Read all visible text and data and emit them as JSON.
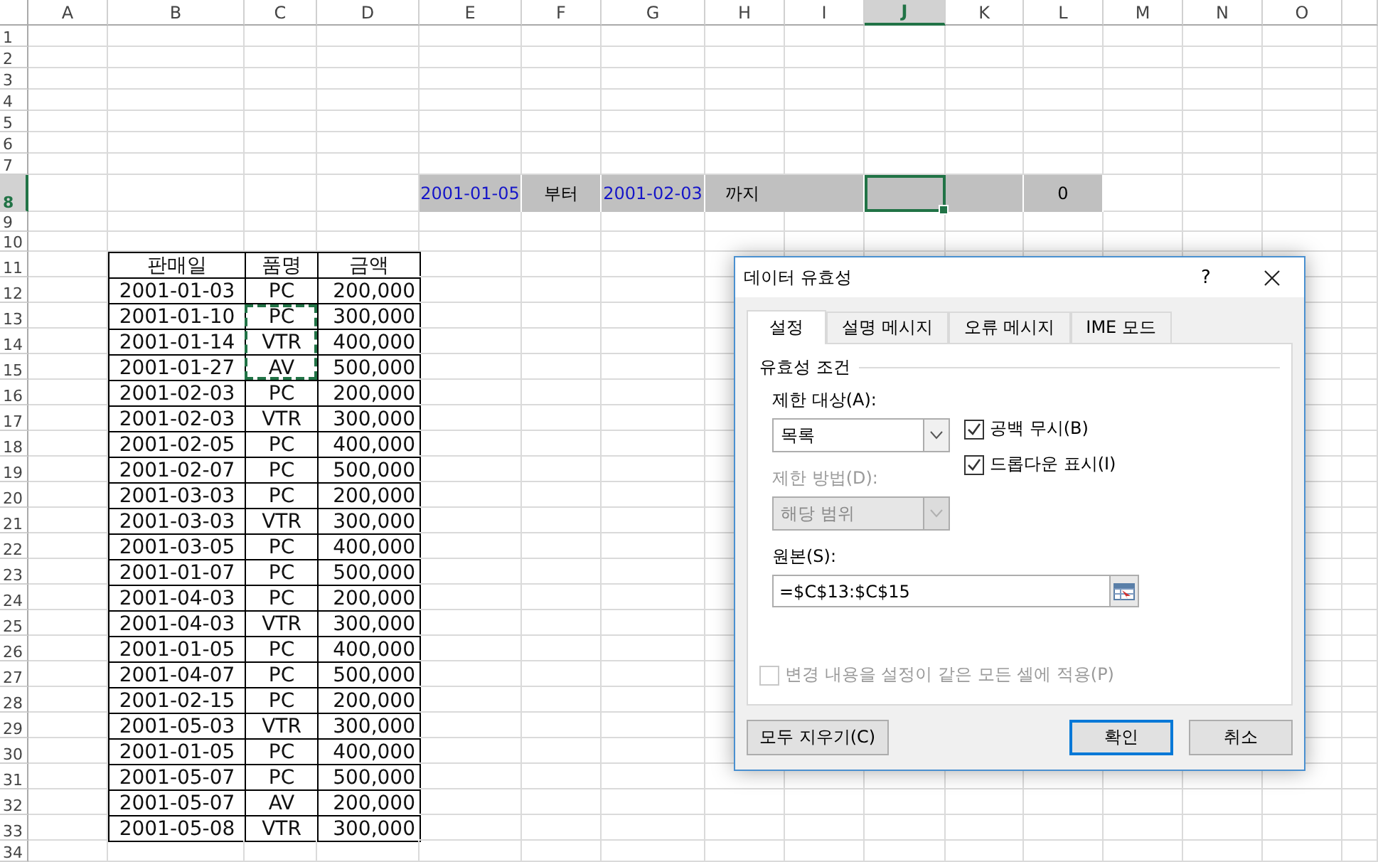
{
  "sheet": {
    "column_headers": [
      {
        "label": "A",
        "selected": false
      },
      {
        "label": "B",
        "selected": false
      },
      {
        "label": "C",
        "selected": false
      },
      {
        "label": "D",
        "selected": false
      },
      {
        "label": "E",
        "selected": false
      },
      {
        "label": "F",
        "selected": false
      },
      {
        "label": "G",
        "selected": false
      },
      {
        "label": "H",
        "selected": false
      },
      {
        "label": "I",
        "selected": false
      },
      {
        "label": "J",
        "selected": true
      },
      {
        "label": "K",
        "selected": false
      },
      {
        "label": "L",
        "selected": false
      },
      {
        "label": "M",
        "selected": false
      },
      {
        "label": "N",
        "selected": false
      },
      {
        "label": "O",
        "selected": false
      }
    ],
    "row_headers": [
      {
        "label": "1",
        "selected": false
      },
      {
        "label": "2",
        "selected": false
      },
      {
        "label": "3",
        "selected": false
      },
      {
        "label": "4",
        "selected": false
      },
      {
        "label": "5",
        "selected": false
      },
      {
        "label": "6",
        "selected": false
      },
      {
        "label": "7",
        "selected": false
      },
      {
        "label": "8",
        "selected": true
      },
      {
        "label": "9",
        "selected": false
      },
      {
        "label": "10",
        "selected": false
      },
      {
        "label": "11",
        "selected": false
      },
      {
        "label": "12",
        "selected": false
      },
      {
        "label": "13",
        "selected": false
      },
      {
        "label": "14",
        "selected": false
      },
      {
        "label": "15",
        "selected": false
      },
      {
        "label": "16",
        "selected": false
      },
      {
        "label": "17",
        "selected": false
      },
      {
        "label": "18",
        "selected": false
      },
      {
        "label": "19",
        "selected": false
      },
      {
        "label": "20",
        "selected": false
      },
      {
        "label": "21",
        "selected": false
      },
      {
        "label": "22",
        "selected": false
      },
      {
        "label": "23",
        "selected": false
      },
      {
        "label": "24",
        "selected": false
      },
      {
        "label": "25",
        "selected": false
      },
      {
        "label": "26",
        "selected": false
      },
      {
        "label": "27",
        "selected": false
      },
      {
        "label": "28",
        "selected": false
      },
      {
        "label": "29",
        "selected": false
      },
      {
        "label": "30",
        "selected": false
      },
      {
        "label": "31",
        "selected": false
      },
      {
        "label": "32",
        "selected": false
      },
      {
        "label": "33",
        "selected": false
      },
      {
        "label": "34",
        "selected": false
      }
    ],
    "criteria": {
      "start_date": "2001-01-05",
      "from_label": "부터",
      "end_date": "2001-02-03",
      "to_label": "까지",
      "active_cell": {
        "selected": true
      },
      "result": "0"
    },
    "table": {
      "columns": [
        "판매일",
        "품명",
        "금액"
      ],
      "rows": [
        {
          "date": "2001-01-03",
          "item": "PC",
          "amount": "200,000",
          "copied": false
        },
        {
          "date": "2001-01-10",
          "item": "PC",
          "amount": "300,000",
          "copied": true
        },
        {
          "date": "2001-01-14",
          "item": "VTR",
          "amount": "400,000",
          "copied": true
        },
        {
          "date": "2001-01-27",
          "item": "AV",
          "amount": "500,000",
          "copied": true
        },
        {
          "date": "2001-02-03",
          "item": "PC",
          "amount": "200,000",
          "copied": false
        },
        {
          "date": "2001-02-03",
          "item": "VTR",
          "amount": "300,000",
          "copied": false
        },
        {
          "date": "2001-02-05",
          "item": "PC",
          "amount": "400,000",
          "copied": false
        },
        {
          "date": "2001-02-07",
          "item": "PC",
          "amount": "500,000",
          "copied": false
        },
        {
          "date": "2001-03-03",
          "item": "PC",
          "amount": "200,000",
          "copied": false
        },
        {
          "date": "2001-03-03",
          "item": "VTR",
          "amount": "300,000",
          "copied": false
        },
        {
          "date": "2001-03-05",
          "item": "PC",
          "amount": "400,000",
          "copied": false
        },
        {
          "date": "2001-01-07",
          "item": "PC",
          "amount": "500,000",
          "copied": false
        },
        {
          "date": "2001-04-03",
          "item": "PC",
          "amount": "200,000",
          "copied": false
        },
        {
          "date": "2001-04-03",
          "item": "VTR",
          "amount": "300,000",
          "copied": false
        },
        {
          "date": "2001-01-05",
          "item": "PC",
          "amount": "400,000",
          "copied": false
        },
        {
          "date": "2001-04-07",
          "item": "PC",
          "amount": "500,000",
          "copied": false
        },
        {
          "date": "2001-02-15",
          "item": "PC",
          "amount": "200,000",
          "copied": false
        },
        {
          "date": "2001-05-03",
          "item": "VTR",
          "amount": "300,000",
          "copied": false
        },
        {
          "date": "2001-01-05",
          "item": "PC",
          "amount": "400,000",
          "copied": false
        },
        {
          "date": "2001-05-07",
          "item": "PC",
          "amount": "500,000",
          "copied": false
        },
        {
          "date": "2001-05-07",
          "item": "AV",
          "amount": "200,000",
          "copied": false
        },
        {
          "date": "2001-05-08",
          "item": "VTR",
          "amount": "300,000",
          "copied": false
        }
      ]
    }
  },
  "dialog": {
    "title": "데이터 유효성",
    "help": "?",
    "tabs": [
      {
        "label": "설정",
        "selected": true
      },
      {
        "label": "설명 메시지",
        "selected": false
      },
      {
        "label": "오류 메시지",
        "selected": false
      },
      {
        "label": "IME 모드",
        "selected": false
      }
    ],
    "group_label": "유효성 조건",
    "allow": {
      "label": "제한 대상(A):",
      "value": "목록",
      "disabled": false
    },
    "data": {
      "label": "제한 방법(D):",
      "value": "해당 범위",
      "disabled": true
    },
    "options": [
      {
        "label": "공백 무시(B)",
        "checked": true,
        "disabled": false
      },
      {
        "label": "드롭다운 표시(I)",
        "checked": true,
        "disabled": false
      }
    ],
    "source": {
      "label": "원본(S):",
      "value": "=$C$13:$C$15"
    },
    "apply_all": {
      "label": "변경 내용을 설정이 같은 모든 셀에 적용(P)",
      "checked": false,
      "disabled": true
    },
    "buttons": [
      {
        "label": "모두 지우기(C)",
        "kind": "clear"
      },
      {
        "label": "확인",
        "kind": "default"
      },
      {
        "label": "취소",
        "kind": "cancel"
      }
    ]
  }
}
